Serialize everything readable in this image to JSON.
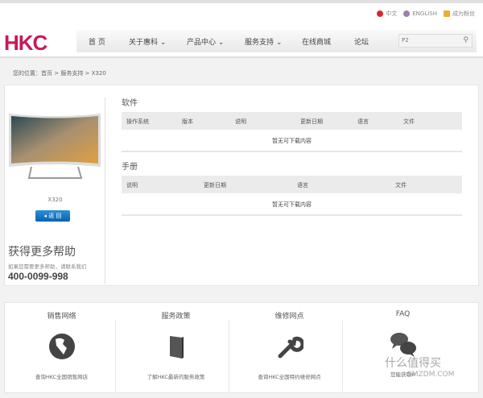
{
  "header": {
    "lang": [
      "中文",
      "ENGLISH",
      "成为粉丝"
    ],
    "logo": "HKC",
    "nav": [
      "首 页",
      "关于惠科 ⌄",
      "产品中心 ⌄",
      "服务支持 ⌄",
      "在线商城",
      "论坛"
    ],
    "search_value": "P2"
  },
  "breadcrumb": "您的位置：首页 > 服务支持 > X320",
  "product": {
    "model": "X320",
    "back": "◂ 返 回",
    "help_title": "获得更多帮助",
    "help_sub": "如果您需要更多帮助，请联系我们",
    "phone": "400-0099-998"
  },
  "software": {
    "title": "软件",
    "cols": [
      "操作系统",
      "版本",
      "说明",
      "更新日期",
      "语言",
      "文件"
    ],
    "empty": "暂无可下载内容"
  },
  "manual": {
    "title": "手册",
    "cols": [
      "说明",
      "更新日期",
      "语言",
      "文件"
    ],
    "empty": "暂无可下载内容"
  },
  "services": [
    {
      "title": "销售网络",
      "desc": "查询HKC全国销售网店"
    },
    {
      "title": "服务政策",
      "desc": "了解HKC最新的服务政策"
    },
    {
      "title": "维修网点",
      "desc": "查询HKC全国特约维修网点"
    },
    {
      "title": "FAQ",
      "desc": "您能获取H"
    }
  ],
  "watermark": {
    "cn": "什么值得买",
    "en": "SMZDM.COM"
  }
}
